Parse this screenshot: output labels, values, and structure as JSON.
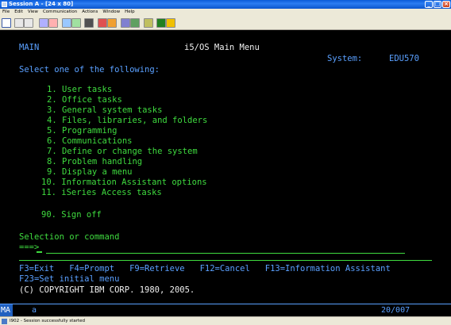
{
  "window": {
    "title": "Session A - [24 x 80]"
  },
  "menubar": {
    "items": [
      "File",
      "Edit",
      "View",
      "Communication",
      "Actions",
      "Window",
      "Help"
    ]
  },
  "screen": {
    "screen_id": "MAIN",
    "heading": "i5/OS Main Menu",
    "system_label": "System:",
    "system_value": "EDU570",
    "prompt": "Select one of the following:",
    "options": [
      "1. User tasks",
      "2. Office tasks",
      "3. General system tasks",
      "4. Files, libraries, and folders",
      "5. Programming",
      "6. Communications",
      "7. Define or change the system",
      "8. Problem handling",
      "9. Display a menu",
      "10. Information Assistant options",
      "11. iSeries Access tasks"
    ],
    "signoff": "90. Sign off",
    "selection_label": "Selection or command",
    "input_arrow": "===>",
    "input_value": "",
    "fkeys_line1": "F3=Exit   F4=Prompt   F9=Retrieve   F12=Cancel   F13=Information Assistant",
    "fkeys_line2": "F23=Set initial menu",
    "copyright": "(C) COPYRIGHT IBM CORP. 1980, 2005."
  },
  "oia": {
    "indicator": "MA",
    "mode": "a",
    "cursor_position": "20/007"
  },
  "statusbar": {
    "message": "I902 - Session successfully started"
  }
}
